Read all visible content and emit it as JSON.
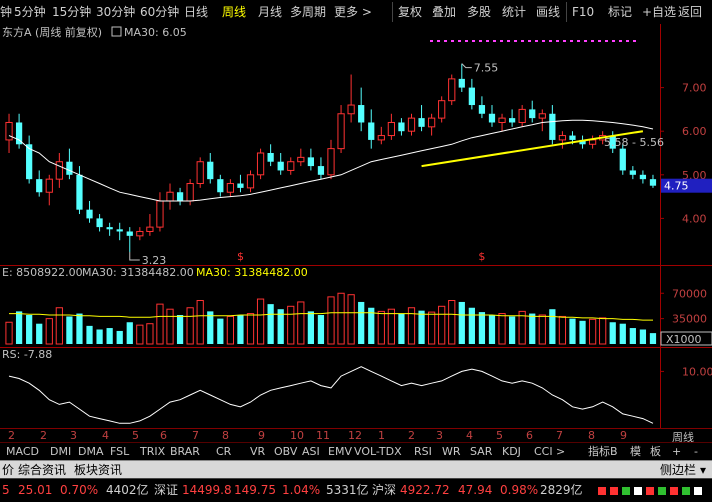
{
  "toolbar": {
    "items": [
      "钟",
      "5分钟",
      "15分钟",
      "30分钟",
      "60分钟",
      "日线",
      "周线",
      "月线",
      "多周期",
      "更多 >",
      "复权",
      "叠加",
      "多股",
      "统计",
      "画线",
      "F10",
      "标记",
      "+自选",
      "返回"
    ],
    "active_index": 6
  },
  "price_panel": {
    "title": "东方A (周线 前复权)",
    "ma_label": "MA30: 6.05",
    "high_label": "7.55",
    "low_label": "3.23",
    "range_label": "5.58 - 5.56",
    "current_price": "4.75",
    "ticks": [
      "7.00",
      "6.00",
      "5.00",
      "4.00"
    ],
    "marker": "$"
  },
  "volume_panel": {
    "vol_label": "E: 8508922.00",
    "ma_label1": "MA30: 31384482.00",
    "ma_label2": "MA30: 31384482.00",
    "ticks": [
      "70000",
      "35000"
    ],
    "unit": "X1000"
  },
  "indicator_panel": {
    "label": "RS: -7.88",
    "ticks": [
      "10.00"
    ]
  },
  "x_axis": {
    "labels": [
      "2",
      "2",
      "3",
      "4",
      "5",
      "6",
      "7",
      "8",
      "9",
      "10",
      "11",
      "12",
      "1",
      "2",
      "3",
      "4",
      "5",
      "6",
      "7",
      "8",
      "9",
      "10"
    ],
    "period_label": "周线"
  },
  "indicator_tabs": [
    "MACD",
    "DMI",
    "DMA",
    "FSL",
    "TRIX",
    "BRAR",
    "CR",
    "VR",
    "OBV",
    "ASI",
    "EMV",
    "VOL-TDX",
    "RSI",
    "WR",
    "SAR",
    "KDJ",
    "CCI",
    ">"
  ],
  "right_tabs": [
    "指标B",
    "模",
    "板"
  ],
  "info_bar": {
    "left_tabs": [
      "价",
      "综合资讯",
      "板块资讯"
    ],
    "sidebar_label": "侧边栏"
  },
  "status_bar": {
    "items": [
      {
        "text": "5",
        "color": "#ff4040"
      },
      {
        "text": "25.01",
        "color": "#ff4040"
      },
      {
        "text": "0.70%",
        "color": "#ff4040"
      },
      {
        "text": "4402亿",
        "color": "#d0d0d0"
      },
      {
        "text": "深证",
        "color": "#d0d0d0"
      },
      {
        "text": "14499.8",
        "color": "#ff4040"
      },
      {
        "text": "149.75",
        "color": "#ff4040"
      },
      {
        "text": "1.04%",
        "color": "#ff4040"
      },
      {
        "text": "5331亿",
        "color": "#d0d0d0"
      },
      {
        "text": "沪深",
        "color": "#d0d0d0"
      },
      {
        "text": "4922.72",
        "color": "#ff4040"
      },
      {
        "text": "47.94",
        "color": "#ff4040"
      },
      {
        "text": "0.98%",
        "color": "#ff4040"
      },
      {
        "text": "2829亿",
        "color": "#d0d0d0"
      }
    ]
  },
  "chart_data": {
    "type": "candlestick",
    "price_range": [
      3.0,
      8.0
    ],
    "candles": [
      [
        5.8,
        6.4,
        5.5,
        6.2
      ],
      [
        6.2,
        6.4,
        5.6,
        5.7
      ],
      [
        5.7,
        5.9,
        4.8,
        4.9
      ],
      [
        4.9,
        5.1,
        4.5,
        4.6
      ],
      [
        4.6,
        5.0,
        4.3,
        4.9
      ],
      [
        4.9,
        5.5,
        4.7,
        5.3
      ],
      [
        5.3,
        5.6,
        4.9,
        5.0
      ],
      [
        5.0,
        5.2,
        4.1,
        4.2
      ],
      [
        4.2,
        4.4,
        3.9,
        4.0
      ],
      [
        4.0,
        4.1,
        3.7,
        3.8
      ],
      [
        3.8,
        3.9,
        3.6,
        3.75
      ],
      [
        3.75,
        3.9,
        3.5,
        3.7
      ],
      [
        3.7,
        3.8,
        3.23,
        3.6
      ],
      [
        3.6,
        3.8,
        3.5,
        3.7
      ],
      [
        3.7,
        4.1,
        3.6,
        3.8
      ],
      [
        3.8,
        4.6,
        3.7,
        4.4
      ],
      [
        4.4,
        4.8,
        4.2,
        4.6
      ],
      [
        4.6,
        4.7,
        4.3,
        4.4
      ],
      [
        4.4,
        4.9,
        4.3,
        4.8
      ],
      [
        4.8,
        5.4,
        4.7,
        5.3
      ],
      [
        5.3,
        5.5,
        4.8,
        4.9
      ],
      [
        4.9,
        5.0,
        4.5,
        4.6
      ],
      [
        4.6,
        4.9,
        4.5,
        4.8
      ],
      [
        4.8,
        5.0,
        4.6,
        4.7
      ],
      [
        4.7,
        5.1,
        4.6,
        5.0
      ],
      [
        5.0,
        5.6,
        4.9,
        5.5
      ],
      [
        5.5,
        5.7,
        5.2,
        5.3
      ],
      [
        5.3,
        5.5,
        5.0,
        5.1
      ],
      [
        5.1,
        5.4,
        5.0,
        5.3
      ],
      [
        5.3,
        5.6,
        5.2,
        5.4
      ],
      [
        5.4,
        5.6,
        5.1,
        5.2
      ],
      [
        5.2,
        5.4,
        4.9,
        5.0
      ],
      [
        5.0,
        5.8,
        4.9,
        5.6
      ],
      [
        5.6,
        6.6,
        5.5,
        6.4
      ],
      [
        6.4,
        7.3,
        6.2,
        6.6
      ],
      [
        6.6,
        7.0,
        6.0,
        6.2
      ],
      [
        6.2,
        6.5,
        5.6,
        5.8
      ],
      [
        5.8,
        6.1,
        5.7,
        5.9
      ],
      [
        5.9,
        6.4,
        5.8,
        6.2
      ],
      [
        6.2,
        6.3,
        5.9,
        6.0
      ],
      [
        6.0,
        6.4,
        5.9,
        6.3
      ],
      [
        6.3,
        6.6,
        6.0,
        6.1
      ],
      [
        6.1,
        6.4,
        5.9,
        6.3
      ],
      [
        6.3,
        6.8,
        6.2,
        6.7
      ],
      [
        6.7,
        7.3,
        6.6,
        7.2
      ],
      [
        7.2,
        7.55,
        6.9,
        7.0
      ],
      [
        7.0,
        7.2,
        6.5,
        6.6
      ],
      [
        6.6,
        6.8,
        6.3,
        6.4
      ],
      [
        6.4,
        6.6,
        6.1,
        6.2
      ],
      [
        6.2,
        6.4,
        6.0,
        6.3
      ],
      [
        6.3,
        6.5,
        6.1,
        6.2
      ],
      [
        6.2,
        6.6,
        6.1,
        6.5
      ],
      [
        6.5,
        6.7,
        6.2,
        6.3
      ],
      [
        6.3,
        6.5,
        6.0,
        6.4
      ],
      [
        6.4,
        6.6,
        5.7,
        5.8
      ],
      [
        5.8,
        6.0,
        5.6,
        5.9
      ],
      [
        5.9,
        6.0,
        5.7,
        5.8
      ],
      [
        5.8,
        5.9,
        5.6,
        5.7
      ],
      [
        5.7,
        5.9,
        5.6,
        5.8
      ],
      [
        5.8,
        6.0,
        5.7,
        5.9
      ],
      [
        5.9,
        6.0,
        5.5,
        5.6
      ],
      [
        5.6,
        5.7,
        5.0,
        5.1
      ],
      [
        5.1,
        5.2,
        4.9,
        5.0
      ],
      [
        5.0,
        5.1,
        4.8,
        4.9
      ],
      [
        4.9,
        5.0,
        4.7,
        4.75
      ]
    ],
    "ma30": [
      5.9,
      5.8,
      5.6,
      5.5,
      5.3,
      5.2,
      5.1,
      5.0,
      4.9,
      4.8,
      4.7,
      4.6,
      4.55,
      4.5,
      4.45,
      4.4,
      4.4,
      4.4,
      4.4,
      4.42,
      4.45,
      4.48,
      4.5,
      4.52,
      4.55,
      4.6,
      4.65,
      4.7,
      4.75,
      4.8,
      4.85,
      4.9,
      4.95,
      5.0,
      5.1,
      5.2,
      5.3,
      5.35,
      5.4,
      5.45,
      5.5,
      5.55,
      5.6,
      5.65,
      5.7,
      5.78,
      5.85,
      5.9,
      5.95,
      6.0,
      6.05,
      6.1,
      6.15,
      6.2,
      6.22,
      6.24,
      6.25,
      6.25,
      6.24,
      6.22,
      6.2,
      6.17,
      6.14,
      6.1,
      6.05
    ],
    "volume": [
      30,
      45,
      40,
      28,
      35,
      50,
      38,
      42,
      25,
      20,
      22,
      18,
      30,
      26,
      28,
      55,
      48,
      40,
      50,
      60,
      45,
      35,
      38,
      40,
      42,
      62,
      55,
      48,
      52,
      58,
      45,
      40,
      65,
      70,
      68,
      58,
      50,
      45,
      48,
      42,
      50,
      46,
      44,
      52,
      60,
      58,
      50,
      44,
      40,
      42,
      38,
      45,
      42,
      40,
      48,
      38,
      35,
      32,
      34,
      36,
      30,
      28,
      22,
      20,
      15
    ],
    "volume_range": [
      0,
      80
    ],
    "vol_ma": [
      42,
      42,
      41,
      41,
      40,
      40,
      40,
      39,
      39,
      38,
      38,
      38,
      37,
      37,
      37,
      38,
      38,
      38,
      38,
      39,
      39,
      39,
      39,
      40,
      40,
      40,
      41,
      41,
      41,
      42,
      42,
      42,
      43,
      43,
      43,
      43,
      43,
      42,
      42,
      42,
      42,
      41,
      41,
      41,
      41,
      40,
      40,
      40,
      40,
      39,
      39,
      39,
      38,
      38,
      38,
      37,
      37,
      36,
      36,
      35,
      35,
      34,
      34,
      33,
      33
    ],
    "rsi": [
      8,
      7,
      5,
      2,
      -2,
      -4,
      -3,
      -6,
      -9,
      -10,
      -11,
      -12,
      -12,
      -11,
      -9,
      -6,
      -3,
      -2,
      0,
      2,
      0,
      -2,
      -4,
      -5,
      -3,
      0,
      2,
      3,
      4,
      5,
      6,
      4,
      3,
      8,
      10,
      12,
      10,
      8,
      6,
      4,
      5,
      4,
      5,
      6,
      8,
      10,
      11,
      10,
      8,
      6,
      5,
      6,
      5,
      3,
      0,
      -2,
      -5,
      -6,
      -5,
      -3,
      -5,
      -8,
      -9,
      -10,
      -12
    ],
    "rsi_range": [
      -14,
      14
    ],
    "highlight_line": {
      "from": [
        41,
        5.2
      ],
      "to": [
        63,
        6.0
      ]
    }
  }
}
